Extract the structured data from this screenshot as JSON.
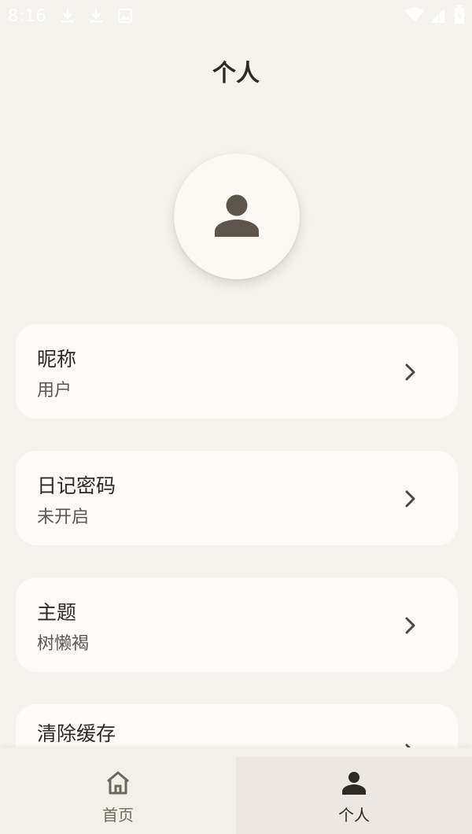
{
  "status_bar": {
    "time": "8:16",
    "icons": [
      "download-icon",
      "download-icon",
      "image-icon",
      "wifi-icon",
      "signal-icon",
      "battery-icon"
    ]
  },
  "header": {
    "title": "个人"
  },
  "avatar": {
    "icon": "person-icon"
  },
  "settings": [
    {
      "label": "昵称",
      "value": "用户"
    },
    {
      "label": "日记密码",
      "value": "未开启"
    },
    {
      "label": "主题",
      "value": "树懒褐"
    },
    {
      "label": "清除缓存",
      "value": ""
    }
  ],
  "bottom_nav": {
    "items": [
      {
        "label": "首页",
        "icon": "home-icon",
        "selected": false
      },
      {
        "label": "个人",
        "icon": "person-icon",
        "selected": true
      }
    ]
  },
  "colors": {
    "background": "#f5f3ee",
    "card": "#fdfbf7",
    "accent": "#5e554d",
    "text": "#2d2a26"
  }
}
